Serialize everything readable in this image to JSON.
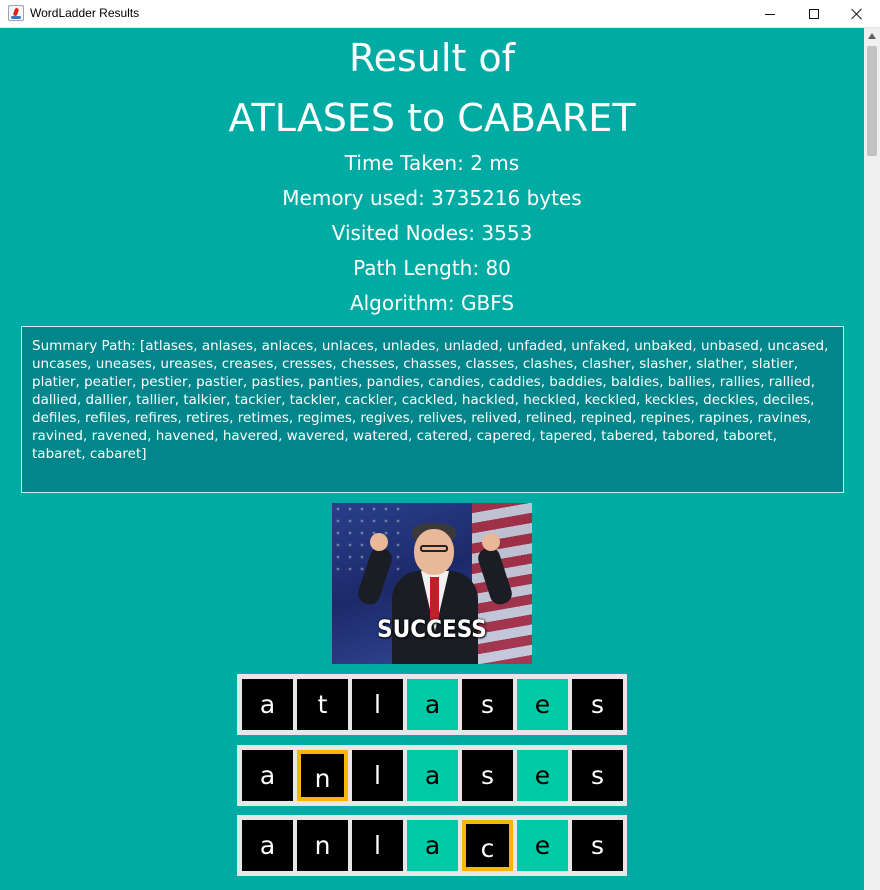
{
  "window": {
    "title": "WordLadder Results"
  },
  "result": {
    "heading_line1": "Result of",
    "heading_line2": "ATLASES to CABARET",
    "time_taken": "Time Taken: 2 ms",
    "memory_used": "Memory used: 3735216 bytes",
    "visited_nodes": "Visited Nodes: 3553",
    "path_length": "Path Length: 80",
    "algorithm": "Algorithm: GBFS"
  },
  "summary": {
    "text": "Summary Path: [atlases, anlases, anlaces, unlaces, unlades, unladed, unfaded, unfaked, unbaked, unbased, uncased, uncases, uneases, ureases, creases, cresses, chesses, chasses, classes, clashes, clasher, slasher, slather, slatier, platier, peatier, pestier, pastier, pasties, panties, pandies, candies, caddies, baddies, baldies, ballies, rallies, rallied, dallied, dallier, tallier, talkier, tackier, tackler, cackler, cackled, hackled, heckled, keckled, keckles, deckles, deciles, defiles, refiles, refires, retires, retimes, regimes, regives, relives, relived, relined, repined, repines, rapines, ravines, ravined, ravened, havened, havered, wavered, watered, catered, capered, tapered, tabered, tabored, taboret, tabaret, cabaret]"
  },
  "success_image": {
    "caption": "SUCCESS"
  },
  "ladder": {
    "rows": [
      {
        "letters": [
          "a",
          "t",
          "l",
          "a",
          "s",
          "e",
          "s"
        ],
        "states": [
          "plain",
          "plain",
          "plain",
          "match",
          "plain",
          "match",
          "plain"
        ]
      },
      {
        "letters": [
          "a",
          "n",
          "l",
          "a",
          "s",
          "e",
          "s"
        ],
        "states": [
          "plain",
          "changed",
          "plain",
          "match",
          "plain",
          "match",
          "plain"
        ]
      },
      {
        "letters": [
          "a",
          "n",
          "l",
          "a",
          "c",
          "e",
          "s"
        ],
        "states": [
          "plain",
          "plain",
          "plain",
          "match",
          "changed",
          "match",
          "plain"
        ]
      }
    ]
  },
  "colors": {
    "background": "#00aba3",
    "summary_background": "#00868b",
    "tile_default": "#000000",
    "tile_match": "#00c9a6",
    "changed_border": "#f5b800"
  },
  "icons": [
    "java-app-icon",
    "minimize-icon",
    "maximize-icon",
    "close-icon"
  ]
}
